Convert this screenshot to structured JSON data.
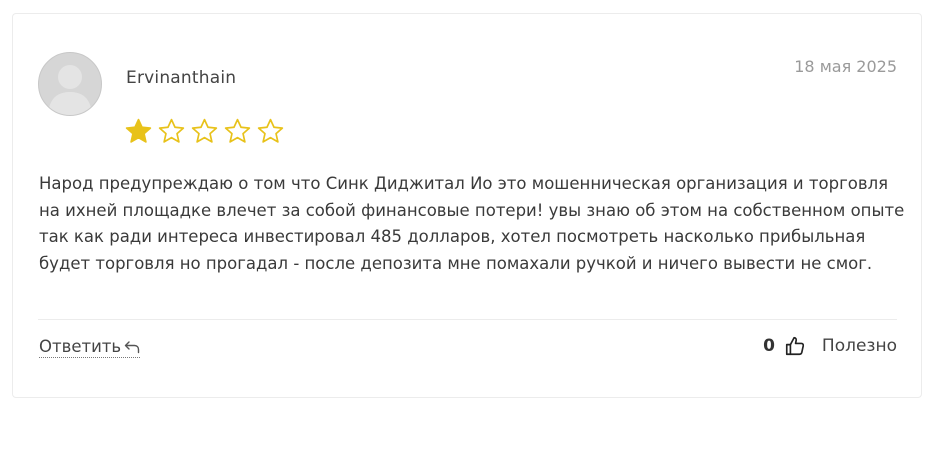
{
  "review": {
    "author": "Ervinanthain",
    "date": "18 мая 2025",
    "rating": 1,
    "rating_max": 5,
    "star_color": "#e8c21a",
    "text": "Народ предупреждаю о том что Синк Диджитал Ио это мошенническая организация и торговля на ихней площадке влечет за собой финансовые потери! увы знаю об этом на собственном опыте так как ради интереса инвестировал 485 долларов, хотел посмотреть насколько прибыльная будет торговля но прогадал - после депозита мне помахали ручкой и ничего вывести не смог."
  },
  "actions": {
    "reply_label": "Ответить",
    "reply_icon": "reply-arrow-icon",
    "helpful_count": "0",
    "helpful_icon": "thumbs-up-icon",
    "helpful_label": "Полезно"
  }
}
